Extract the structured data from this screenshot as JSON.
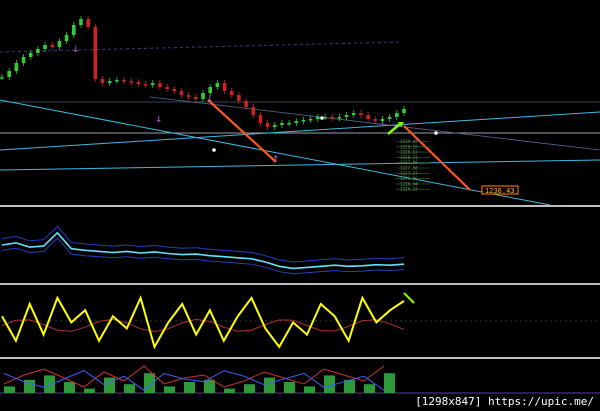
{
  "chart_data": [
    {
      "type": "line",
      "pane": "price",
      "title": "",
      "series": [
        {
          "values": [
            98,
            104,
            112,
            118,
            122,
            126,
            130,
            128,
            134,
            140,
            150,
            156,
            148,
            96,
            92,
            94,
            95,
            94,
            93,
            91,
            90,
            92,
            88,
            86,
            84,
            80,
            78,
            76,
            82,
            88,
            92,
            84,
            80,
            74,
            68,
            60,
            52,
            48,
            50,
            52,
            52,
            54,
            55,
            56,
            58,
            58,
            57,
            58,
            60,
            62,
            60,
            56,
            54,
            56,
            58,
            62,
            66
          ]
        }
      ],
      "price_label": "1236.43",
      "ladder_labels": [
        "1229.45",
        "1229.15",
        "1228.52",
        "1228.21",
        "1227.90",
        "1227.58",
        "1227.27",
        "1226.96",
        "1226.64",
        "1226.33"
      ]
    },
    {
      "type": "line",
      "pane": "indicator-1",
      "series": [
        {
          "values": [
            0.62,
            0.66,
            0.58,
            0.6,
            0.85,
            0.55,
            0.52,
            0.5,
            0.48,
            0.5,
            0.47,
            0.49,
            0.46,
            0.44,
            0.45,
            0.42,
            0.4,
            0.38,
            0.36,
            0.3,
            0.22,
            0.18,
            0.2,
            0.22,
            0.24,
            0.22,
            0.23,
            0.25,
            0.24,
            0.26
          ]
        }
      ]
    },
    {
      "type": "line",
      "pane": "oscillator",
      "series": [
        {
          "values": [
            0.6,
            0.2,
            0.8,
            0.3,
            0.9,
            0.5,
            0.7,
            0.2,
            0.6,
            0.4,
            0.9,
            0.1,
            0.5,
            0.8,
            0.3,
            0.7,
            0.2,
            0.6,
            0.9,
            0.4,
            0.1,
            0.5,
            0.3,
            0.8,
            0.6,
            0.2,
            0.9,
            0.5,
            0.7,
            0.85
          ]
        }
      ]
    },
    {
      "type": "bar",
      "pane": "histogram",
      "values": [
        0.3,
        0.6,
        0.8,
        0.5,
        0.2,
        0.7,
        0.4,
        0.9,
        0.3,
        0.5,
        0.6,
        0.2,
        0.4,
        0.7,
        0.5,
        0.3,
        0.8,
        0.6,
        0.4,
        0.9
      ]
    }
  ],
  "footer": {
    "credit": "[1298x847] https://upic.me/"
  },
  "colors": {
    "background": "#000000",
    "separator": "#bfbfbf",
    "up_candle": "#33cc33",
    "down_candle": "#cc2222",
    "trend_line": "#ff5522",
    "channel": "#3fb8e0",
    "oscillator": "#ffff00"
  }
}
